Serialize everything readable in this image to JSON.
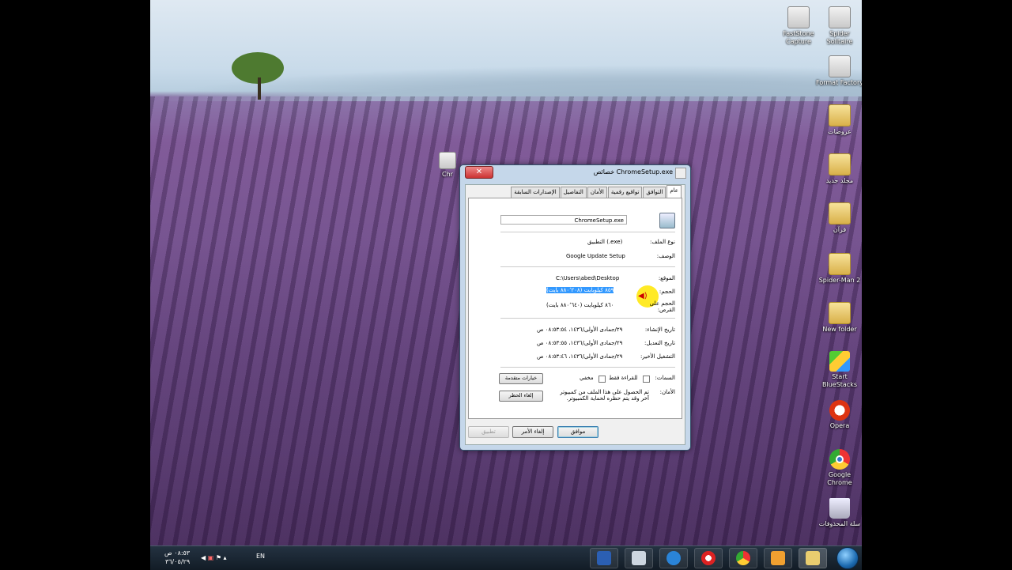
{
  "desktop": {
    "icons": [
      {
        "name": "faststone-icon",
        "label": "FastStone Capture"
      },
      {
        "name": "spider-solitaire-icon",
        "label": "Spider Solitaire"
      },
      {
        "name": "format-factory-icon",
        "label": "Format Factory"
      },
      {
        "name": "folder-icon",
        "label": "عروضات"
      },
      {
        "name": "folder-icon",
        "label": "مجلد جديد"
      },
      {
        "name": "folder-icon",
        "label": "قرآن"
      },
      {
        "name": "folder-icon",
        "label": "Spider-Man 2"
      },
      {
        "name": "folder-icon",
        "label": "New folder"
      },
      {
        "name": "bluestacks-icon",
        "label": "Start BlueStacks"
      },
      {
        "name": "opera-icon",
        "label": "Opera"
      },
      {
        "name": "chrome-icon",
        "label": "Google Chrome"
      },
      {
        "name": "recycle-bin-icon",
        "label": "سلة المحذوفات"
      }
    ],
    "partial_icon_label": "Chr"
  },
  "dialog": {
    "title": "خصائص ChromeSetup.exe",
    "tabs": [
      "عام",
      "التوافق",
      "تواقيع رقمية",
      "الأمان",
      "التفاصيل",
      "الإصدارات السابقة"
    ],
    "file_name": "ChromeSetup.exe",
    "rows": {
      "type_label": "نوع الملف:",
      "type_value": "التطبيق (.exe)",
      "desc_label": "الوصف:",
      "desc_value": "Google Update Setup",
      "location_label": "الموقع:",
      "location_value": "C:\\Users\\abed\\Desktop",
      "size_label": "الحجم:",
      "size_value": "٨٥٩ كيلوبايت (٨٨٠٬٢٠٨ بايت)",
      "disk_label": "الحجم على القرص:",
      "disk_value": "٨٦٠ كيلوبايت (٨٨٠٬٦٤٠ بايت)",
      "created_label": "تاريخ الإنشاء:",
      "created_value": "٢٩/جمادى الأولى/١٤٣٦، ٠٨:٥٣:٥٤ ص",
      "modified_label": "تاريخ التعديل:",
      "modified_value": "٢٩/جمادى الأولى/١٤٣٦، ٠٨:٥٣:٥٥ ص",
      "accessed_label": "التشغيل الأخير:",
      "accessed_value": "٢٩/جمادى الأولى/١٤٣٦، ٠٨:٥٣:٤٦ ص",
      "attrs_label": "السمات:",
      "readonly_label": "للقراءة فقط",
      "hidden_label": "مخفي",
      "advanced_button": "خيارات متقدمة",
      "security_label": "الأمان:",
      "security_text": "تم الحصول على هذا الملف من كمبيوتر آخر وقد يتم حظره لحماية الكمبيوتر.",
      "unblock_button": "إلغاء الحظر"
    },
    "buttons": {
      "ok": "موافق",
      "cancel": "إلغاء الأمر",
      "apply": "تطبيق"
    }
  },
  "taskbar": {
    "time": "٠٨:٥٣ ص",
    "date": "٣٦/٠٥/٢٩",
    "lang": "EN"
  }
}
